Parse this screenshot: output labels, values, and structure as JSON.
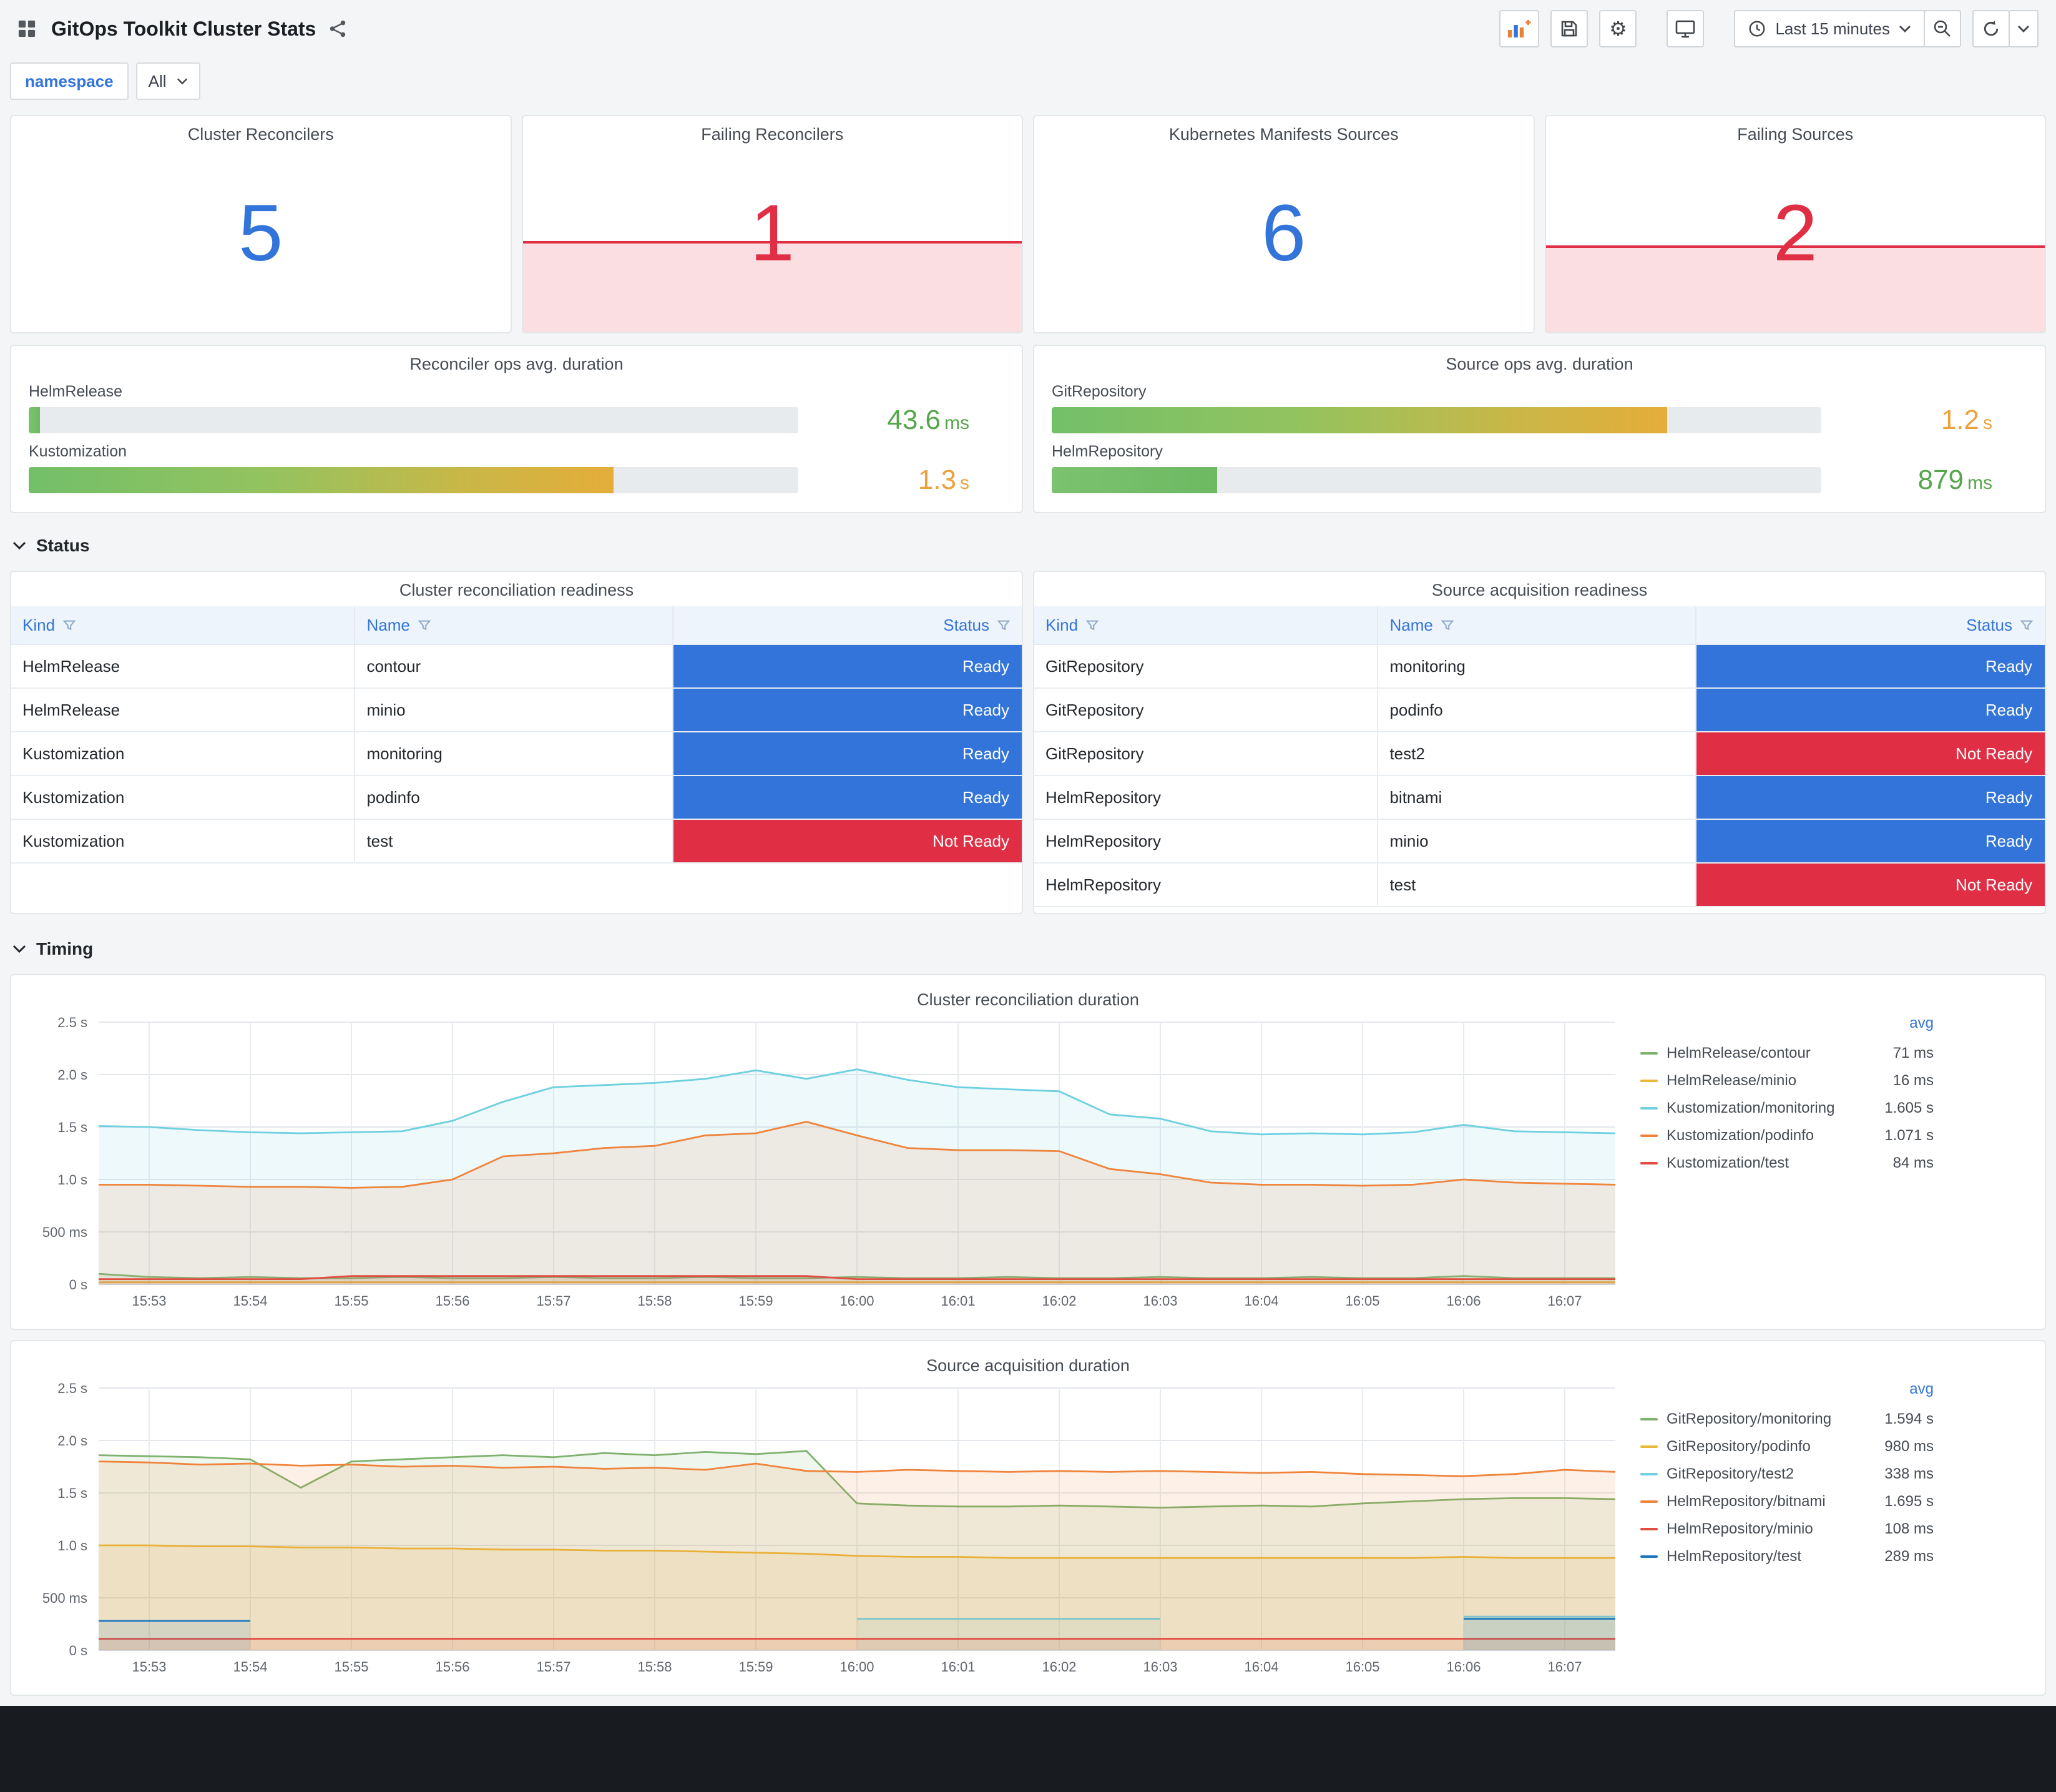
{
  "header": {
    "title": "GitOps Toolkit Cluster Stats",
    "time_range": "Last 15 minutes"
  },
  "variables": {
    "label": "namespace",
    "value": "All"
  },
  "sections": {
    "status": "Status",
    "timing": "Timing"
  },
  "colors": {
    "stat_blue": "#3274D9",
    "stat_red": "#E02F44",
    "ready": "#3274D9",
    "not_ready": "#E02F44",
    "green_text": "#56A64B",
    "orange_text": "#EDA13C"
  },
  "stats": [
    {
      "title": "Cluster Reconcilers",
      "value": "5",
      "state": "ok",
      "fill_pct": 0
    },
    {
      "title": "Failing Reconcilers",
      "value": "1",
      "state": "failing",
      "fill_pct": 41
    },
    {
      "title": "Kubernetes Manifests Sources",
      "value": "6",
      "state": "ok",
      "fill_pct": 0
    },
    {
      "title": "Failing Sources",
      "value": "2",
      "state": "failing",
      "fill_pct": 39
    }
  ],
  "gauges": [
    {
      "title": "Reconciler ops avg. duration",
      "rows": [
        {
          "label": "HelmRelease",
          "percent": 1.5,
          "style": "green",
          "value": "43.6",
          "unit": "ms",
          "value_color": "green"
        },
        {
          "label": "Kustomization",
          "percent": 76,
          "style": "gradient",
          "value": "1.3",
          "unit": "s",
          "value_color": "orange"
        }
      ]
    },
    {
      "title": "Source ops avg. duration",
      "rows": [
        {
          "label": "GitRepository",
          "percent": 80,
          "style": "gradient",
          "value": "1.2",
          "unit": "s",
          "value_color": "orange"
        },
        {
          "label": "HelmRepository",
          "percent": 21.5,
          "style": "green",
          "value": "879",
          "unit": "ms",
          "value_color": "green"
        }
      ]
    }
  ],
  "tables": [
    {
      "title": "Cluster reconciliation readiness",
      "columns": [
        "Kind",
        "Name",
        "Status"
      ],
      "rows": [
        [
          "HelmRelease",
          "contour",
          "Ready"
        ],
        [
          "HelmRelease",
          "minio",
          "Ready"
        ],
        [
          "Kustomization",
          "monitoring",
          "Ready"
        ],
        [
          "Kustomization",
          "podinfo",
          "Ready"
        ],
        [
          "Kustomization",
          "test",
          "Not Ready"
        ]
      ]
    },
    {
      "title": "Source acquisition readiness",
      "columns": [
        "Kind",
        "Name",
        "Status"
      ],
      "rows": [
        [
          "GitRepository",
          "monitoring",
          "Ready"
        ],
        [
          "GitRepository",
          "podinfo",
          "Ready"
        ],
        [
          "GitRepository",
          "test2",
          "Not Ready"
        ],
        [
          "HelmRepository",
          "bitnami",
          "Ready"
        ],
        [
          "HelmRepository",
          "minio",
          "Ready"
        ],
        [
          "HelmRepository",
          "test",
          "Not Ready"
        ]
      ]
    }
  ],
  "status_colors": {
    "Ready": "#3274D9",
    "Not Ready": "#E02F44"
  },
  "chart_data": [
    {
      "type": "line",
      "title": "Cluster reconciliation duration",
      "legend_value_header": "avg",
      "ylim": [
        0,
        2.5
      ],
      "x_domain_minutes": 15,
      "sample_step_minutes": 0.5,
      "grid": true,
      "legend_position": "right",
      "y_ticks": [
        {
          "v": 0,
          "label": "0 s"
        },
        {
          "v": 0.5,
          "label": "500 ms"
        },
        {
          "v": 1,
          "label": "1.0 s"
        },
        {
          "v": 1.5,
          "label": "1.5 s"
        },
        {
          "v": 2,
          "label": "2.0 s"
        },
        {
          "v": 2.5,
          "label": "2.5 s"
        }
      ],
      "x_ticks": [
        "15:53",
        "15:54",
        "15:55",
        "15:56",
        "15:57",
        "15:58",
        "15:59",
        "16:00",
        "16:01",
        "16:02",
        "16:03",
        "16:04",
        "16:05",
        "16:06",
        "16:07"
      ],
      "series": [
        {
          "name": "HelmRelease/contour",
          "color": "#7EB26D",
          "avg": "71 ms",
          "values": [
            0.1,
            0.07,
            0.06,
            0.07,
            0.06,
            0.06,
            0.07,
            0.06,
            0.06,
            0.07,
            0.06,
            0.06,
            0.07,
            0.06,
            0.06,
            0.07,
            0.06,
            0.06,
            0.07,
            0.06,
            0.06,
            0.07,
            0.06,
            0.06,
            0.07,
            0.06,
            0.06,
            0.08,
            0.06,
            0.06,
            0.06
          ]
        },
        {
          "name": "HelmRelease/minio",
          "color": "#EAB839",
          "avg": "16 ms",
          "values": [
            0.02,
            0.02,
            0.02,
            0.02,
            0.02,
            0.02,
            0.02,
            0.02,
            0.02,
            0.02,
            0.02,
            0.02,
            0.02,
            0.02,
            0.02,
            0.02,
            0.02,
            0.02,
            0.02,
            0.02,
            0.02,
            0.02,
            0.02,
            0.02,
            0.02,
            0.02,
            0.02,
            0.02,
            0.02,
            0.02,
            0.02
          ]
        },
        {
          "name": "Kustomization/monitoring",
          "color": "#6ED0E0",
          "avg": "1.605 s",
          "values": [
            1.51,
            1.5,
            1.47,
            1.45,
            1.44,
            1.45,
            1.46,
            1.56,
            1.74,
            1.88,
            1.9,
            1.92,
            1.96,
            2.04,
            1.96,
            2.05,
            1.95,
            1.88,
            1.86,
            1.84,
            1.62,
            1.58,
            1.46,
            1.43,
            1.44,
            1.43,
            1.45,
            1.52,
            1.46,
            1.45,
            1.44
          ]
        },
        {
          "name": "Kustomization/podinfo",
          "color": "#EF843C",
          "avg": "1.071 s",
          "values": [
            0.95,
            0.95,
            0.94,
            0.93,
            0.93,
            0.92,
            0.93,
            1.0,
            1.22,
            1.25,
            1.3,
            1.32,
            1.42,
            1.44,
            1.55,
            1.42,
            1.3,
            1.28,
            1.28,
            1.27,
            1.1,
            1.05,
            0.97,
            0.95,
            0.95,
            0.94,
            0.95,
            1.0,
            0.97,
            0.96,
            0.95
          ]
        },
        {
          "name": "Kustomization/test",
          "color": "#E24D42",
          "avg": "84 ms",
          "values": [
            0.05,
            0.05,
            0.05,
            0.05,
            0.05,
            0.08,
            0.08,
            0.08,
            0.08,
            0.08,
            0.08,
            0.08,
            0.08,
            0.08,
            0.08,
            0.05,
            0.05,
            0.05,
            0.05,
            0.05,
            0.05,
            0.05,
            0.05,
            0.05,
            0.05,
            0.05,
            0.05,
            0.05,
            0.05,
            0.05,
            0.05
          ]
        }
      ]
    },
    {
      "type": "line",
      "title": "Source acquisition duration",
      "legend_value_header": "avg",
      "ylim": [
        0,
        2.5
      ],
      "x_domain_minutes": 15,
      "sample_step_minutes": 0.5,
      "grid": true,
      "legend_position": "right",
      "y_ticks": [
        {
          "v": 0,
          "label": "0 s"
        },
        {
          "v": 0.5,
          "label": "500 ms"
        },
        {
          "v": 1,
          "label": "1.0 s"
        },
        {
          "v": 1.5,
          "label": "1.5 s"
        },
        {
          "v": 2,
          "label": "2.0 s"
        },
        {
          "v": 2.5,
          "label": "2.5 s"
        }
      ],
      "x_ticks": [
        "15:53",
        "15:54",
        "15:55",
        "15:56",
        "15:57",
        "15:58",
        "15:59",
        "16:00",
        "16:01",
        "16:02",
        "16:03",
        "16:04",
        "16:05",
        "16:06",
        "16:07"
      ],
      "series": [
        {
          "name": "GitRepository/monitoring",
          "color": "#7EB26D",
          "avg": "1.594 s",
          "values": [
            1.86,
            1.85,
            1.84,
            1.82,
            1.55,
            1.8,
            1.82,
            1.84,
            1.86,
            1.84,
            1.88,
            1.86,
            1.89,
            1.87,
            1.9,
            1.4,
            1.38,
            1.37,
            1.37,
            1.38,
            1.37,
            1.36,
            1.37,
            1.38,
            1.37,
            1.4,
            1.42,
            1.44,
            1.45,
            1.45,
            1.44
          ]
        },
        {
          "name": "GitRepository/podinfo",
          "color": "#EAB839",
          "avg": "980 ms",
          "values": [
            1.0,
            1.0,
            0.99,
            0.99,
            0.98,
            0.98,
            0.97,
            0.97,
            0.96,
            0.96,
            0.95,
            0.95,
            0.94,
            0.93,
            0.92,
            0.9,
            0.89,
            0.89,
            0.88,
            0.88,
            0.88,
            0.88,
            0.88,
            0.88,
            0.88,
            0.88,
            0.88,
            0.89,
            0.88,
            0.88,
            0.88
          ]
        },
        {
          "name": "GitRepository/test2",
          "color": "#6ED0E0",
          "avg": "338 ms",
          "values": [
            null,
            null,
            null,
            null,
            null,
            null,
            null,
            null,
            null,
            null,
            null,
            null,
            null,
            null,
            null,
            0.3,
            0.3,
            0.3,
            0.3,
            0.3,
            0.3,
            0.3,
            null,
            null,
            null,
            null,
            null,
            0.32,
            0.32,
            0.32,
            0.32
          ]
        },
        {
          "name": "HelmRepository/bitnami",
          "color": "#EF843C",
          "avg": "1.695 s",
          "values": [
            1.8,
            1.79,
            1.77,
            1.78,
            1.76,
            1.77,
            1.75,
            1.76,
            1.74,
            1.75,
            1.73,
            1.74,
            1.72,
            1.78,
            1.71,
            1.7,
            1.72,
            1.71,
            1.7,
            1.71,
            1.7,
            1.71,
            1.7,
            1.69,
            1.7,
            1.68,
            1.67,
            1.66,
            1.68,
            1.72,
            1.7
          ]
        },
        {
          "name": "HelmRepository/minio",
          "color": "#E24D42",
          "avg": "108 ms",
          "values": [
            0.11,
            0.11,
            0.11,
            0.11,
            0.11,
            0.11,
            0.11,
            0.11,
            0.11,
            0.11,
            0.11,
            0.11,
            0.11,
            0.11,
            0.11,
            0.11,
            0.11,
            0.11,
            0.11,
            0.11,
            0.11,
            0.11,
            0.11,
            0.11,
            0.11,
            0.11,
            0.11,
            0.11,
            0.11,
            0.11,
            0.11
          ]
        },
        {
          "name": "HelmRepository/test",
          "color": "#1F78C1",
          "avg": "289 ms",
          "values": [
            0.28,
            0.28,
            0.28,
            0.28,
            null,
            null,
            null,
            null,
            null,
            null,
            null,
            null,
            null,
            null,
            null,
            null,
            null,
            null,
            null,
            null,
            null,
            null,
            null,
            null,
            null,
            null,
            null,
            0.3,
            0.3,
            0.3,
            0.3
          ]
        }
      ]
    }
  ]
}
